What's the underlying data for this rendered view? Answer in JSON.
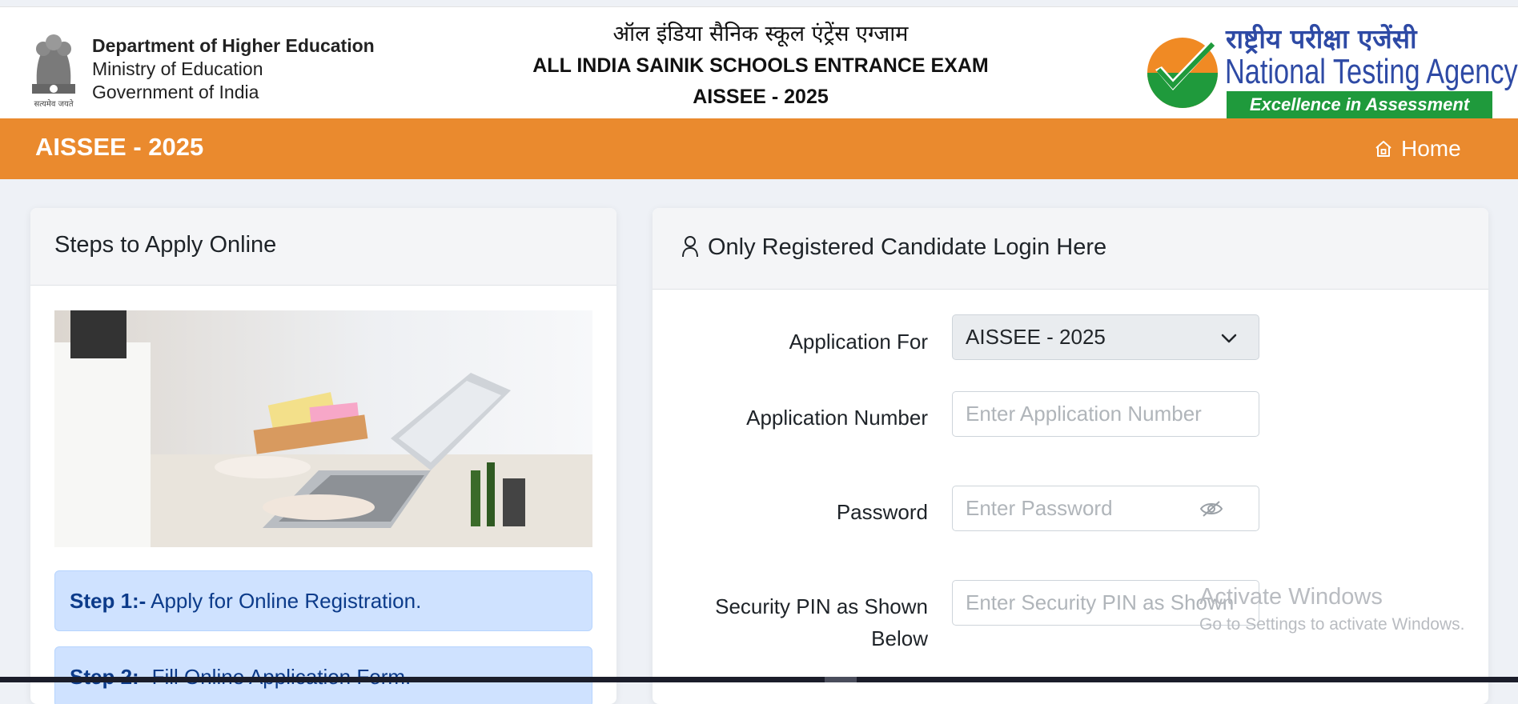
{
  "header": {
    "dept_line1": "Department of Higher Education",
    "dept_line2": "Ministry of Education",
    "dept_line3": "Government of India",
    "emblem_caption": "सत्यमेव जयते",
    "title_hindi": "ऑल इंडिया सैनिक स्कूल एंट्रेंस एग्जाम",
    "title_english": "ALL INDIA SAINIK SCHOOLS ENTRANCE EXAM",
    "title_code": "AISSEE - 2025",
    "nta_hindi": "राष्ट्रीय परीक्षा एजेंसी",
    "nta_english": "National Testing Agency",
    "nta_tagline": "Excellence in Assessment"
  },
  "navbar": {
    "title": "AISSEE - 2025",
    "home_label": "Home",
    "color": "#ea8a2e"
  },
  "steps_panel": {
    "title": "Steps to Apply Online",
    "steps": [
      {
        "prefix": "Step 1:-",
        "text": " Apply for Online Registration."
      },
      {
        "prefix": "Step 2:-",
        "text": " Fill Online Application Form."
      }
    ]
  },
  "login_panel": {
    "title": "Only Registered Candidate Login Here",
    "application_for_label": "Application For",
    "application_for_value": "AISSEE - 2025",
    "application_number_label": "Application Number",
    "application_number_placeholder": "Enter Application Number",
    "password_label": "Password",
    "password_placeholder": "Enter Password",
    "security_pin_label_line1": "Security PIN as Shown",
    "security_pin_label_line2": "Below",
    "security_pin_placeholder": "Enter Security PIN as Shown"
  },
  "watermark": {
    "line1": "Activate Windows",
    "line2": "Go to Settings to activate Windows."
  },
  "icons": [
    "emblem-icon",
    "nta-logo-icon",
    "home-icon",
    "user-icon",
    "chevron-down-icon",
    "eye-slash-icon"
  ]
}
